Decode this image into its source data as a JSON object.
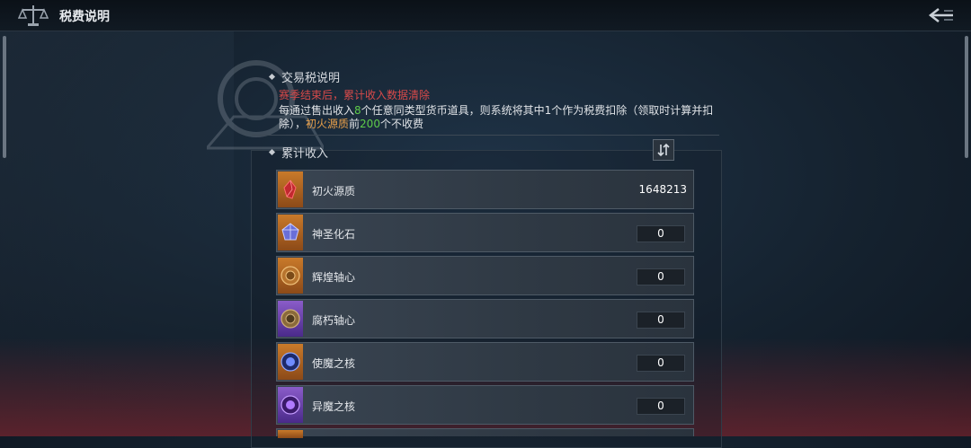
{
  "header": {
    "title": "税费说明"
  },
  "tax_section": {
    "heading": "交易税说明",
    "warning": "赛季结束后，累计收入数据清除",
    "desc_part1": "每通过售出收入",
    "desc_num1": "8",
    "desc_part2": "个任意同类型货币道具，则系统将其中1个作为税费扣除（领取时计算并扣除），",
    "desc_currency": "初火源质",
    "desc_part3": "前",
    "desc_num2": "200",
    "desc_part4": "个不收费"
  },
  "cumulative": {
    "heading": "累计收入",
    "items": [
      {
        "name": "初火源质",
        "value": "1648213",
        "icon": "red-crystal-icon"
      },
      {
        "name": "神圣化石",
        "value": "0",
        "icon": "holy-fossil-icon"
      },
      {
        "name": "辉煌轴心",
        "value": "0",
        "icon": "glory-axis-icon"
      },
      {
        "name": "腐朽轴心",
        "value": "0",
        "icon": "decay-axis-icon"
      },
      {
        "name": "使魔之核",
        "value": "0",
        "icon": "familiar-core-icon"
      },
      {
        "name": "异魔之核",
        "value": "0",
        "icon": "demon-core-icon"
      }
    ]
  },
  "colors": {
    "warning": "#d84a4a",
    "highlight_green": "#5ecb4a",
    "highlight_orange": "#e9a04a"
  }
}
